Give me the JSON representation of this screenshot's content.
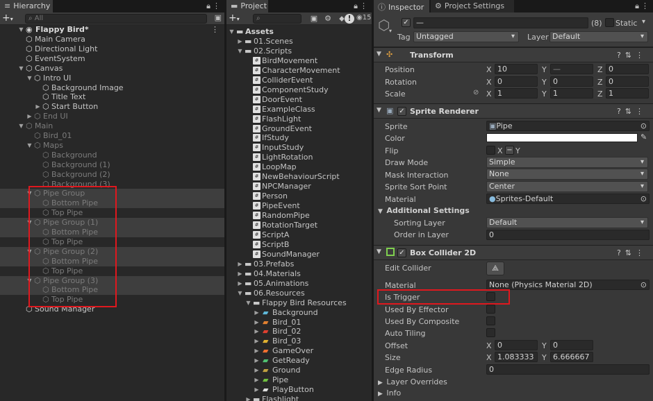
{
  "hierarchy": {
    "tab_label": "Hierarchy",
    "search_placeholder": "All",
    "scene": "Flappy Bird*",
    "rows": [
      {
        "label": "Main Camera"
      },
      {
        "label": "Directional Light"
      },
      {
        "label": "EventSystem"
      },
      {
        "label": "Canvas"
      },
      {
        "label": "Intro UI"
      },
      {
        "label": "Background Image"
      },
      {
        "label": "Title Text"
      },
      {
        "label": "Start Button"
      },
      {
        "label": "End UI"
      },
      {
        "label": "Main"
      },
      {
        "label": "Bird_01"
      },
      {
        "label": "Maps"
      },
      {
        "label": "Background"
      },
      {
        "label": "Background (1)"
      },
      {
        "label": "Background (2)"
      },
      {
        "label": "Background (3)"
      },
      {
        "label": "Pipe Group"
      },
      {
        "label": "Bottom Pipe"
      },
      {
        "label": "Top Pipe"
      },
      {
        "label": "Pipe Group (1)"
      },
      {
        "label": "Bottom Pipe"
      },
      {
        "label": "Top Pipe"
      },
      {
        "label": "Pipe Group (2)"
      },
      {
        "label": "Bottom Pipe"
      },
      {
        "label": "Top Pipe"
      },
      {
        "label": "Pipe Group (3)"
      },
      {
        "label": "Bottom Pipe"
      },
      {
        "label": "Top Pipe"
      },
      {
        "label": "Sound Manager"
      }
    ]
  },
  "project": {
    "tab_label": "Project",
    "hidden_count": "15",
    "rows": [
      {
        "label": "Assets"
      },
      {
        "label": "01.Scenes"
      },
      {
        "label": "02.Scripts"
      },
      {
        "label": "BirdMovement"
      },
      {
        "label": "CharacterMovement"
      },
      {
        "label": "ColliderEvent"
      },
      {
        "label": "ComponentStudy"
      },
      {
        "label": "DoorEvent"
      },
      {
        "label": "ExampleClass"
      },
      {
        "label": "FlashLight"
      },
      {
        "label": "GroundEvent"
      },
      {
        "label": "IfStudy"
      },
      {
        "label": "InputStudy"
      },
      {
        "label": "LightRotation"
      },
      {
        "label": "LoopMap"
      },
      {
        "label": "NewBehaviourScript"
      },
      {
        "label": "NPCManager"
      },
      {
        "label": "Person"
      },
      {
        "label": "PipeEvent"
      },
      {
        "label": "RandomPipe"
      },
      {
        "label": "RotationTarget"
      },
      {
        "label": "ScriptA"
      },
      {
        "label": "ScriptB"
      },
      {
        "label": "SoundManager"
      },
      {
        "label": "03.Prefabs"
      },
      {
        "label": "04.Materials"
      },
      {
        "label": "05.Animations"
      },
      {
        "label": "06.Resources"
      },
      {
        "label": "Flappy Bird Resources"
      },
      {
        "label": "Background"
      },
      {
        "label": "Bird_01"
      },
      {
        "label": "Bird_02"
      },
      {
        "label": "Bird_03"
      },
      {
        "label": "GameOver"
      },
      {
        "label": "GetReady"
      },
      {
        "label": "Ground"
      },
      {
        "label": "Pipe"
      },
      {
        "label": "PlayButton"
      },
      {
        "label": "Flashlight"
      }
    ]
  },
  "inspector": {
    "tab_label": "Inspector",
    "settings_tab_label": "Project Settings",
    "object_name": "—",
    "selection_count": "(8)",
    "static_label": "Static",
    "tag_label": "Tag",
    "tag_value": "Untagged",
    "layer_label": "Layer",
    "layer_value": "Default",
    "transform": {
      "title": "Transform",
      "position_label": "Position",
      "rotation_label": "Rotation",
      "scale_label": "Scale",
      "axes": [
        "X",
        "Y",
        "Z"
      ],
      "position": [
        "10",
        "—",
        "0"
      ],
      "rotation": [
        "0",
        "0",
        "0"
      ],
      "scale": [
        "1",
        "1",
        "1"
      ]
    },
    "sprite_renderer": {
      "title": "Sprite Renderer",
      "sprite_label": "Sprite",
      "sprite_value": "Pipe",
      "color_label": "Color",
      "color_value": "#ffffff",
      "flip_label": "Flip",
      "flip_x": "X",
      "flip_y": "Y",
      "draw_mode_label": "Draw Mode",
      "draw_mode_value": "Simple",
      "mask_label": "Mask Interaction",
      "mask_value": "None",
      "sort_point_label": "Sprite Sort Point",
      "sort_point_value": "Center",
      "material_label": "Material",
      "material_value": "Sprites-Default",
      "additional_label": "Additional Settings",
      "sorting_layer_label": "Sorting Layer",
      "sorting_layer_value": "Default",
      "order_label": "Order in Layer",
      "order_value": "0"
    },
    "box_collider": {
      "title": "Box Collider 2D",
      "edit_label": "Edit Collider",
      "material_label": "Material",
      "material_value": "None (Physics Material 2D)",
      "is_trigger_label": "Is Trigger",
      "effector_label": "Used By Effector",
      "composite_label": "Used By Composite",
      "auto_tiling_label": "Auto Tiling",
      "offset_label": "Offset",
      "offset": [
        "0",
        "0"
      ],
      "size_label": "Size",
      "size": [
        "1.083333",
        "6.666667"
      ],
      "edge_label": "Edge Radius",
      "edge_value": "0",
      "layer_overrides_label": "Layer Overrides",
      "info_label": "Info"
    }
  }
}
